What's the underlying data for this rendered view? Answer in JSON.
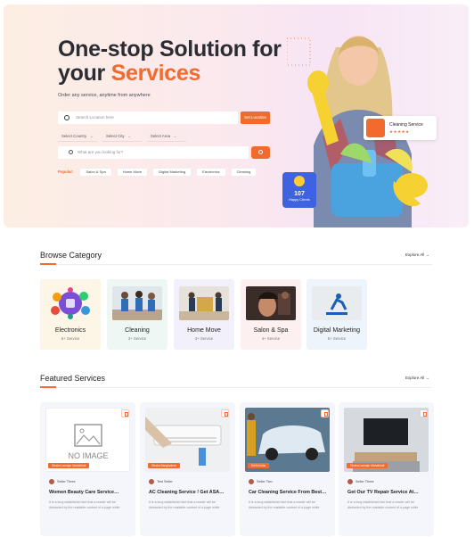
{
  "hero": {
    "title_line1": "One-stop Solution for",
    "title_line2_prefix": "your",
    "title_line2_accent": "Services",
    "subtitle": "Order any service, anytime from anywhere",
    "location_placeholder": "Search Location here",
    "location_button": "Set Location",
    "select_country": "Select Country",
    "select_city": "Select City",
    "select_area": "Select Area",
    "search_placeholder": "What are you looking for?",
    "popular_label": "Popular:",
    "popular_chips": [
      "Salon & Spa",
      "Home Move",
      "Digital Marketing",
      "Electronics",
      "Cleaning"
    ],
    "happy_count": "107",
    "happy_label": "Happy Clients",
    "cleaning_badge": "Cleaning Service",
    "cleaning_stars": "★★★★★"
  },
  "browse": {
    "title": "Browse Category",
    "explore": "Explore All →",
    "categories": [
      {
        "name": "Electronics",
        "count": "5+ Service",
        "bg": "#fdf6e6"
      },
      {
        "name": "Cleaning",
        "count": "3+ Service",
        "bg": "#eef7f3"
      },
      {
        "name": "Home Move",
        "count": "3+ Service",
        "bg": "#f2f0fb"
      },
      {
        "name": "Salon & Spa",
        "count": "4+ Service",
        "bg": "#fcf0f1"
      },
      {
        "name": "Digital Marketing",
        "count": "6+ Service",
        "bg": "#eef4fb"
      }
    ]
  },
  "featured": {
    "title": "Featured Services",
    "explore": "Explore All →",
    "no_image": "NO IMAGE",
    "services": [
      {
        "tag": "Dhaka Lamajor Mahakhali",
        "seller": "Seller Three",
        "title": "Women Beauty Care Service…",
        "desc": "It is a long established fact that a reader will be distracted by the readable content of a page while"
      },
      {
        "tag": "Dhaka Bangladesh",
        "seller": "Test Seller",
        "title": "AC Cleaning Service ! Get ASA…",
        "desc": "It is a long established fact that a reader will be distracted by the readable content of a page while"
      },
      {
        "tag": "Delhi India",
        "seller": "Seller Two",
        "title": "Car Cleaning Service From Best…",
        "desc": "It is a long established fact that a reader will be distracted by the readable content of a page while"
      },
      {
        "tag": "Dhaka Lamajor Mahakhali",
        "seller": "Seller Three",
        "title": "Get Our TV Repair Service At…",
        "desc": "It is a long established fact that a reader will be distracted by the readable content of a page while"
      }
    ]
  },
  "colors": {
    "accent": "#f26a2d",
    "badge_blue": "#3f63e0"
  }
}
